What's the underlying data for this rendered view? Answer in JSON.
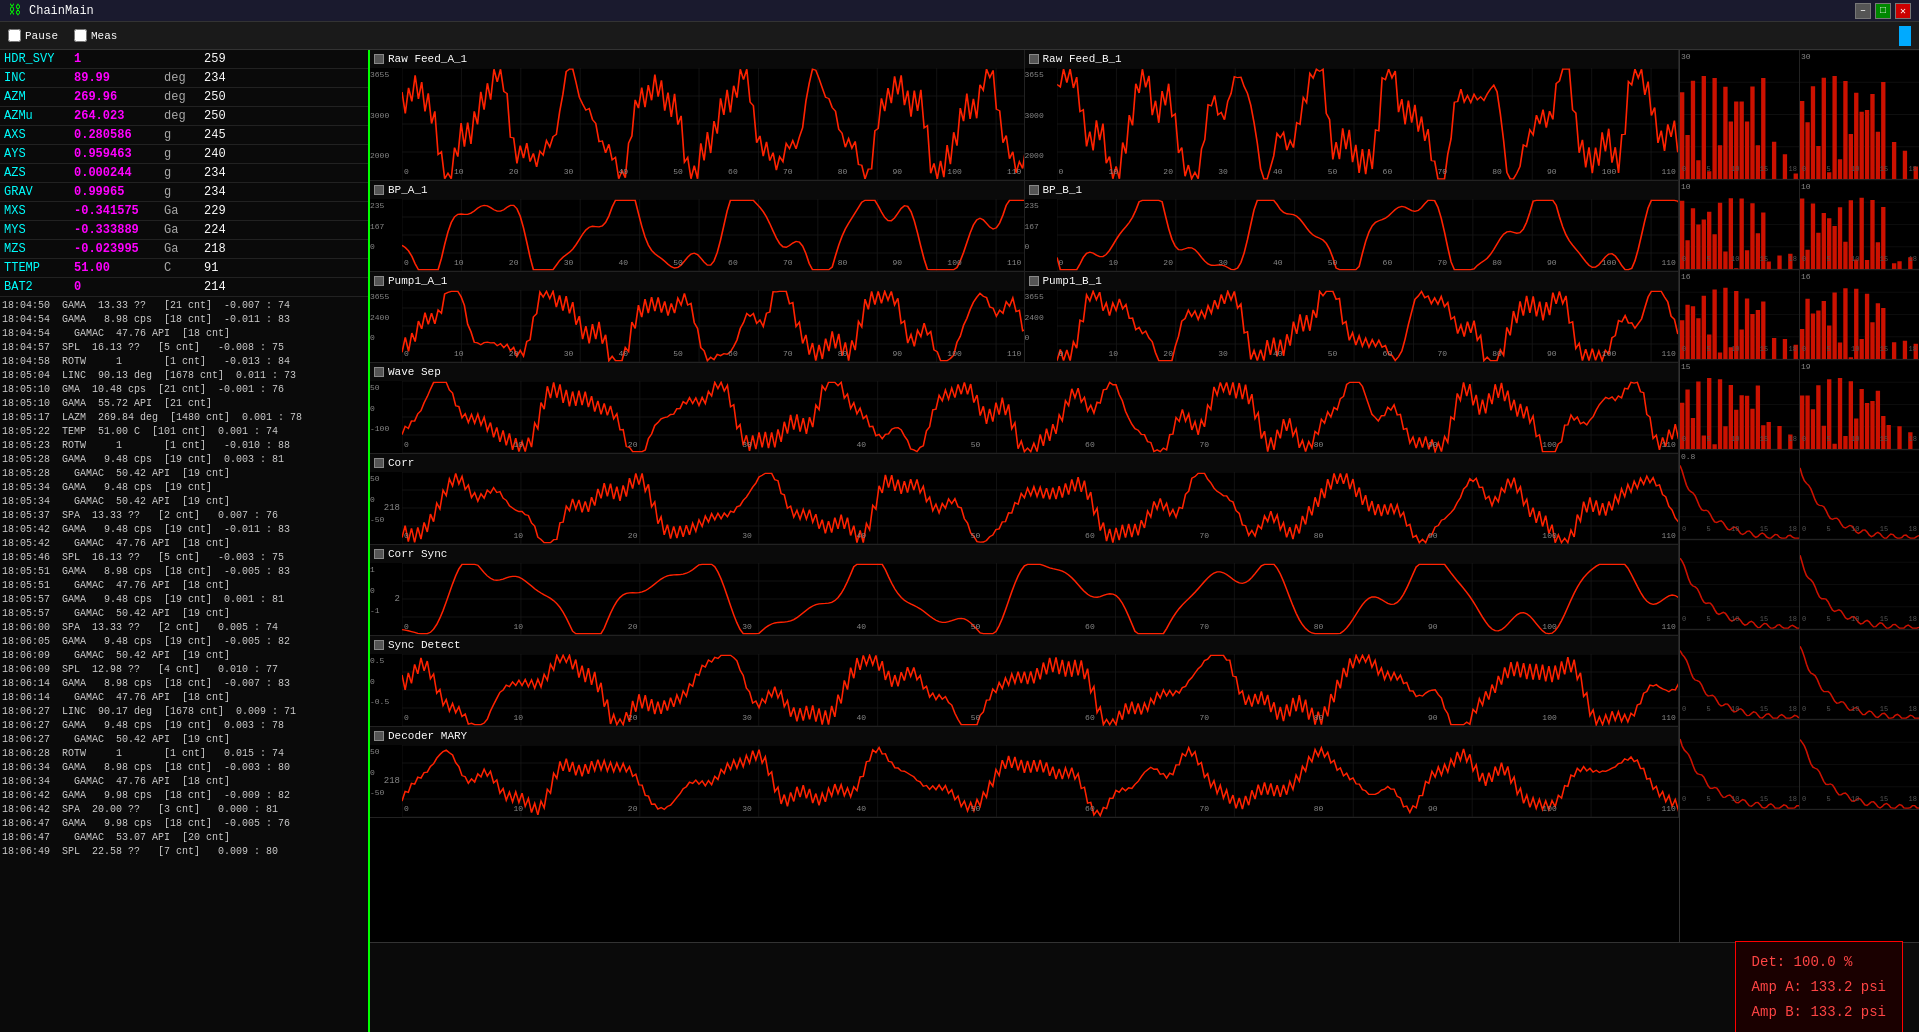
{
  "titleBar": {
    "title": "ChainMain",
    "minimize": "–",
    "maximize": "□",
    "close": "✕"
  },
  "toolbar": {
    "pause_label": "Pause",
    "meas_label": "Meas"
  },
  "statusTable": {
    "rows": [
      {
        "name": "HDR_SVY",
        "value": "1",
        "unit": "",
        "num": "259"
      },
      {
        "name": "INC",
        "value": "89.99",
        "unit": "deg",
        "num": "234"
      },
      {
        "name": "AZM",
        "value": "269.96",
        "unit": "deg",
        "num": "250"
      },
      {
        "name": "AZMu",
        "value": "264.023",
        "unit": "deg",
        "num": "250"
      },
      {
        "name": "AXS",
        "value": "0.280586",
        "unit": "g",
        "num": "245"
      },
      {
        "name": "AYS",
        "value": "0.959463",
        "unit": "g",
        "num": "240"
      },
      {
        "name": "AZS",
        "value": "0.000244",
        "unit": "g",
        "num": "234"
      },
      {
        "name": "GRAV",
        "value": "0.99965",
        "unit": "g",
        "num": "234"
      },
      {
        "name": "MXS",
        "value": "-0.341575",
        "unit": "Ga",
        "num": "229"
      },
      {
        "name": "MYS",
        "value": "-0.333889",
        "unit": "Ga",
        "num": "224"
      },
      {
        "name": "MZS",
        "value": "-0.023995",
        "unit": "Ga",
        "num": "218"
      },
      {
        "name": "TTEMP",
        "value": "51.00",
        "unit": "C",
        "num": "91"
      },
      {
        "name": "BAT2",
        "value": "0",
        "unit": "",
        "num": "214"
      }
    ]
  },
  "logLines": [
    "18:04:50  GAMA  13.33 ??   [21 cnt]  -0.007 : 74",
    "18:04:54  GAMA   8.98 cps  [18 cnt]  -0.011 : 83",
    "18:04:54    GAMAC  47.76 API  [18 cnt]",
    "18:04:57  SPL  16.13 ??   [5 cnt]   -0.008 : 75",
    "18:04:58  ROTW     1       [1 cnt]   -0.013 : 84",
    "18:05:04  LINC  90.13 deg  [1678 cnt]  0.011 : 73",
    "18:05:10  GMA  10.48 cps  [21 cnt]  -0.001 : 76",
    "18:05:10  GAMA  55.72 API  [21 cnt]",
    "18:05:17  LAZM  269.84 deg  [1480 cnt]  0.001 : 78",
    "18:05:22  TEMP  51.00 C  [101 cnt]  0.001 : 74",
    "18:05:23  ROTW     1       [1 cnt]   -0.010 : 88",
    "18:05:28  GAMA   9.48 cps  [19 cnt]  0.003 : 81",
    "18:05:28    GAMAC  50.42 API  [19 cnt]",
    "18:05:34  GAMA   9.48 cps  [19 cnt]",
    "18:05:34    GAMAC  50.42 API  [19 cnt]",
    "18:05:37  SPA  13.33 ??   [2 cnt]   0.007 : 76",
    "18:05:42  GAMA   9.48 cps  [19 cnt]  -0.011 : 83",
    "18:05:42    GAMAC  47.76 API  [18 cnt]",
    "18:05:46  SPL  16.13 ??   [5 cnt]   -0.003 : 75",
    "18:05:51  GAMA   8.98 cps  [18 cnt]  -0.005 : 83",
    "18:05:51    GAMAC  47.76 API  [18 cnt]",
    "18:05:57  GAMA   9.48 cps  [19 cnt]  0.001 : 81",
    "18:05:57    GAMAC  50.42 API  [19 cnt]",
    "18:06:00  SPA  13.33 ??   [2 cnt]   0.005 : 74",
    "18:06:05  GAMA   9.48 cps  [19 cnt]  -0.005 : 82",
    "18:06:09    GAMAC  50.42 API  [19 cnt]",
    "18:06:09  SPL  12.98 ??   [4 cnt]   0.010 : 77",
    "18:06:14  GAMA   8.98 cps  [18 cnt]  -0.007 : 83",
    "18:06:14    GAMAC  47.76 API  [18 cnt]",
    "18:06:27  LINC  90.17 deg  [1678 cnt]  0.009 : 71",
    "18:06:27  GAMA   9.48 cps  [19 cnt]  0.003 : 78",
    "18:06:27    GAMAC  50.42 API  [19 cnt]",
    "18:06:28  ROTW     1       [1 cnt]   0.015 : 74",
    "18:06:34  GAMA   8.98 cps  [18 cnt]  -0.003 : 80",
    "18:06:34    GAMAC  47.76 API  [18 cnt]",
    "18:06:42  GAMA   9.98 cps  [18 cnt]  -0.009 : 82",
    "18:06:42  SPA  20.00 ??   [3 cnt]   0.000 : 81",
    "18:06:47  GAMA   9.98 cps  [18 cnt]  -0.005 : 76",
    "18:06:47    GAMAC  53.07 API  [20 cnt]",
    "18:06:49  SPL  22.58 ??   [7 cnt]   0.009 : 80"
  ],
  "charts": [
    {
      "id": "raw_feed",
      "type": "double",
      "left": {
        "title": "Raw Feed_A_1",
        "ymin": "2000",
        "ymid": "3000",
        "ymax": "3655",
        "color": "#ff2200"
      },
      "right": {
        "title": "Raw Feed_B_1",
        "ymin": "2000",
        "ymid": "3000",
        "ymax": "3655",
        "color": "#ff2200"
      }
    },
    {
      "id": "bp",
      "type": "double",
      "left": {
        "title": "BP_A_1",
        "ymin": "0",
        "ymid": "167",
        "ymax": "235",
        "color": "#ff2200"
      },
      "right": {
        "title": "BP_B_1",
        "ymin": "0",
        "ymid": "167",
        "ymax": "235",
        "color": "#ff2200"
      }
    },
    {
      "id": "pump1",
      "type": "double",
      "left": {
        "title": "Pump1_A_1",
        "ymin": "0",
        "ymid": "2400",
        "ymax": "3655",
        "color": "#ff2200"
      },
      "right": {
        "title": "Pump1_B_1",
        "ymin": "0",
        "ymid": "2400",
        "ymax": "3655",
        "color": "#ff2200"
      }
    },
    {
      "id": "wave_sep",
      "type": "single",
      "left": {
        "title": "Wave Sep",
        "ymin": "-100",
        "ymid": "0",
        "ymax": "50",
        "color": "#ff2200"
      }
    },
    {
      "id": "corr",
      "type": "single",
      "left": {
        "title": "Corr",
        "ymin": "-50",
        "ymid": "0",
        "ymax": "50",
        "color": "#ff2200",
        "yval": "218"
      }
    },
    {
      "id": "corr_sync",
      "type": "single",
      "left": {
        "title": "Corr Sync",
        "ymin": "-1",
        "ymid": "0",
        "ymax": "1",
        "color": "#ff2200",
        "yval": "2"
      }
    },
    {
      "id": "sync_detect",
      "type": "single",
      "left": {
        "title": "Sync Detect",
        "ymin": "-0.5",
        "ymid": "0",
        "ymax": "0.5",
        "color": "#ff2200"
      }
    },
    {
      "id": "decoder_mary",
      "type": "single",
      "left": {
        "title": "Decoder MARY",
        "ymin": "-50",
        "ymid": "0",
        "ymax": "50",
        "color": "#ff2200",
        "yval": "218"
      }
    }
  ],
  "sideCharts": {
    "pairs": [
      {
        "leftLabel": "30",
        "rightLabel": "30"
      },
      {
        "leftLabel": "10",
        "rightLabel": "10"
      },
      {
        "leftLabel": "16",
        "rightLabel": "16"
      },
      {
        "leftLabel": "15",
        "rightLabel": "19"
      },
      {
        "leftLabel": "0.8",
        "rightLabel": ""
      },
      {
        "leftLabel": "",
        "rightLabel": ""
      },
      {
        "leftLabel": "",
        "rightLabel": ""
      },
      {
        "leftLabel": "",
        "rightLabel": ""
      }
    ]
  },
  "bottomStatus": {
    "det_label": "Det: 100.0 %",
    "ampA_label": "Amp A: 133.2 psi",
    "ampB_label": "Amp B: 133.2 psi"
  },
  "xAxisLabels": [
    "0",
    "10",
    "20",
    "30",
    "40",
    "50",
    "60",
    "70",
    "80",
    "90",
    "100",
    "110"
  ]
}
